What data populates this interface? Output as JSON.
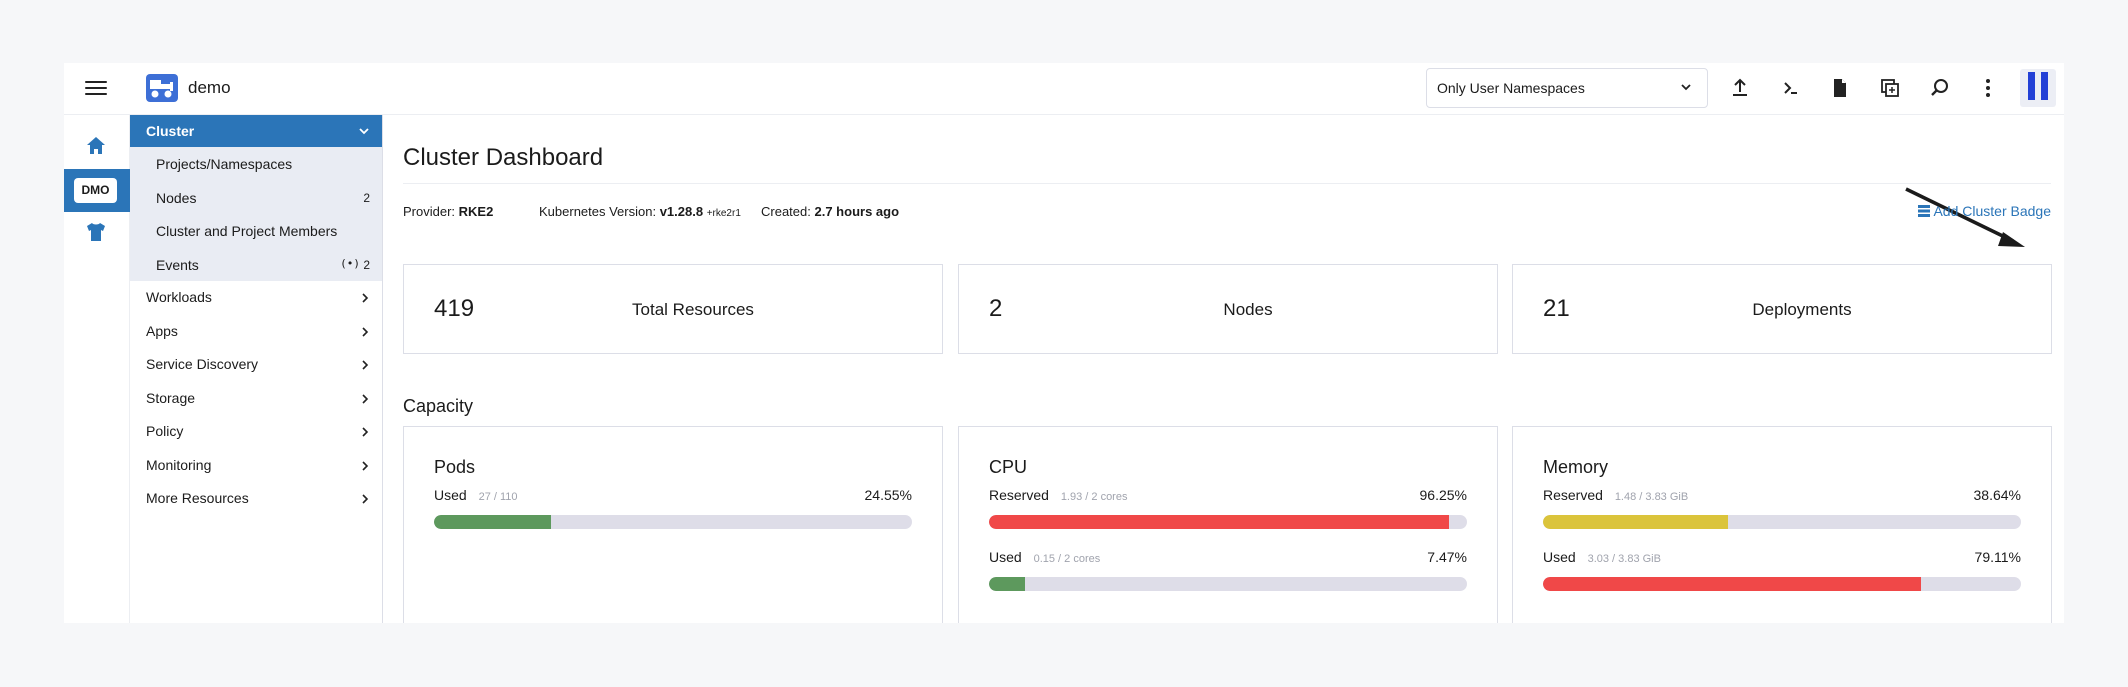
{
  "header": {
    "cluster_name": "demo",
    "namespace_filter": "Only User Namespaces",
    "icons": [
      "upload-icon",
      "terminal-icon",
      "file-icon",
      "copy-config-icon",
      "search-icon",
      "more-icon"
    ]
  },
  "rail": {
    "cluster_badge": "DMO"
  },
  "sidebar": {
    "header": "Cluster",
    "sub_items": [
      {
        "label": "Projects/Namespaces",
        "count": ""
      },
      {
        "label": "Nodes",
        "count": "2"
      },
      {
        "label": "Cluster and Project Members",
        "count": ""
      },
      {
        "label": "Events",
        "count": "2"
      }
    ],
    "groups": [
      {
        "label": "Workloads"
      },
      {
        "label": "Apps"
      },
      {
        "label": "Service Discovery"
      },
      {
        "label": "Storage"
      },
      {
        "label": "Policy"
      },
      {
        "label": "Monitoring"
      },
      {
        "label": "More Resources"
      }
    ]
  },
  "main": {
    "title": "Cluster Dashboard",
    "provider_label": "Provider:",
    "provider_value": "RKE2",
    "k8s_label": "Kubernetes Version:",
    "k8s_value": "v1.28.8",
    "k8s_suffix": "+rke2r1",
    "created_label": "Created:",
    "created_value": "2.7 hours ago",
    "badge_link": "Add Cluster Badge",
    "stats": [
      {
        "value": "419",
        "label": "Total Resources"
      },
      {
        "value": "2",
        "label": "Nodes"
      },
      {
        "value": "21",
        "label": "Deployments"
      }
    ],
    "capacity_title": "Capacity",
    "capacity": [
      {
        "title": "Pods",
        "rows": [
          {
            "label": "Used",
            "sub": "27 / 110",
            "pct": "24.55%",
            "fraction": 0.2455,
            "color": "#5d995d"
          }
        ]
      },
      {
        "title": "CPU",
        "rows": [
          {
            "label": "Reserved",
            "sub": "1.93 / 2 cores",
            "pct": "96.25%",
            "fraction": 0.9625,
            "color": "#f04848"
          },
          {
            "label": "Used",
            "sub": "0.15 / 2 cores",
            "pct": "7.47%",
            "fraction": 0.0747,
            "color": "#5d995d"
          }
        ]
      },
      {
        "title": "Memory",
        "rows": [
          {
            "label": "Reserved",
            "sub": "1.48 / 3.83 GiB",
            "pct": "38.64%",
            "fraction": 0.3864,
            "color": "#dbc43b"
          },
          {
            "label": "Used",
            "sub": "3.03 / 3.83 GiB",
            "pct": "79.11%",
            "fraction": 0.7911,
            "color": "#f04848"
          }
        ]
      }
    ]
  },
  "colors": {
    "accent": "#2b75b8",
    "ok": "#5d995d",
    "warn": "#dbc43b",
    "error": "#f04848"
  }
}
